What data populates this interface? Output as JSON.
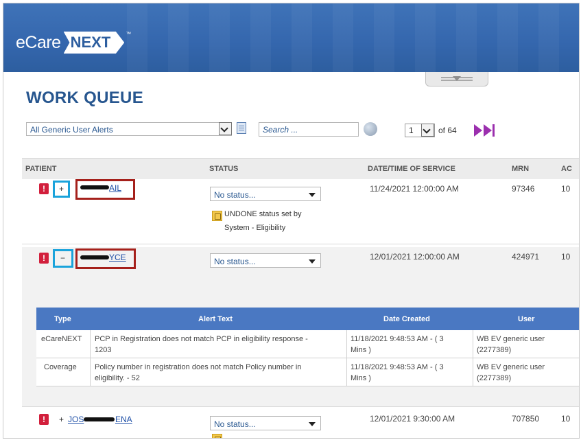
{
  "app": {
    "logo_ecare": "eCare",
    "logo_next": "NEXT",
    "logo_tm": "™"
  },
  "page": {
    "title": "WORK QUEUE"
  },
  "toolbar": {
    "filter_value": "All Generic User Alerts",
    "search_placeholder": "Search ...",
    "page_current": "1",
    "page_of": "of 64"
  },
  "table": {
    "headers": {
      "patient": "PATIENT",
      "status": "STATUS",
      "date": "DATE/TIME OF SERVICE",
      "mrn": "MRN",
      "extra": "AC"
    },
    "rows": [
      {
        "alert": "!",
        "expand": "+",
        "name_suffix": "AIL",
        "status": "No status...",
        "date": "11/24/2021 12:00:00 AM",
        "mrn": "97346",
        "extra": "10",
        "note_line1": "UNDONE status set by",
        "note_line2": "System - Eligibility"
      },
      {
        "alert": "!",
        "expand": "−",
        "name_suffix": "YCE",
        "status": "No status...",
        "date": "12/01/2021 12:00:00 AM",
        "mrn": "424971",
        "extra": "10"
      },
      {
        "alert": "!",
        "expand": "+",
        "name_prefix": "JOS",
        "name_suffix": "ENA",
        "status": "No status...",
        "date": "12/01/2021 9:30:00 AM",
        "mrn": "707850",
        "extra": "10"
      }
    ]
  },
  "alerts_table": {
    "headers": {
      "type": "Type",
      "alert_text": "Alert Text",
      "date_created": "Date Created",
      "user": "User"
    },
    "rows": [
      {
        "type": "eCareNEXT",
        "text_line1": "PCP in Registration does not match PCP in eligibility response -",
        "text_line2": "1203",
        "date_line1": "11/18/2021 9:48:53 AM - ( 3",
        "date_line2": "Mins )",
        "user_line1": "WB EV generic user",
        "user_line2": "(2277389)"
      },
      {
        "type": "Coverage",
        "text_line1": "Policy number in registration does not match Policy number in",
        "text_line2": "eligibility. - 52",
        "date_line1": "11/18/2021 9:48:53 AM - ( 3",
        "date_line2": "Mins )",
        "user_line1": "WB EV generic user",
        "user_line2": "(2277389)"
      }
    ]
  }
}
